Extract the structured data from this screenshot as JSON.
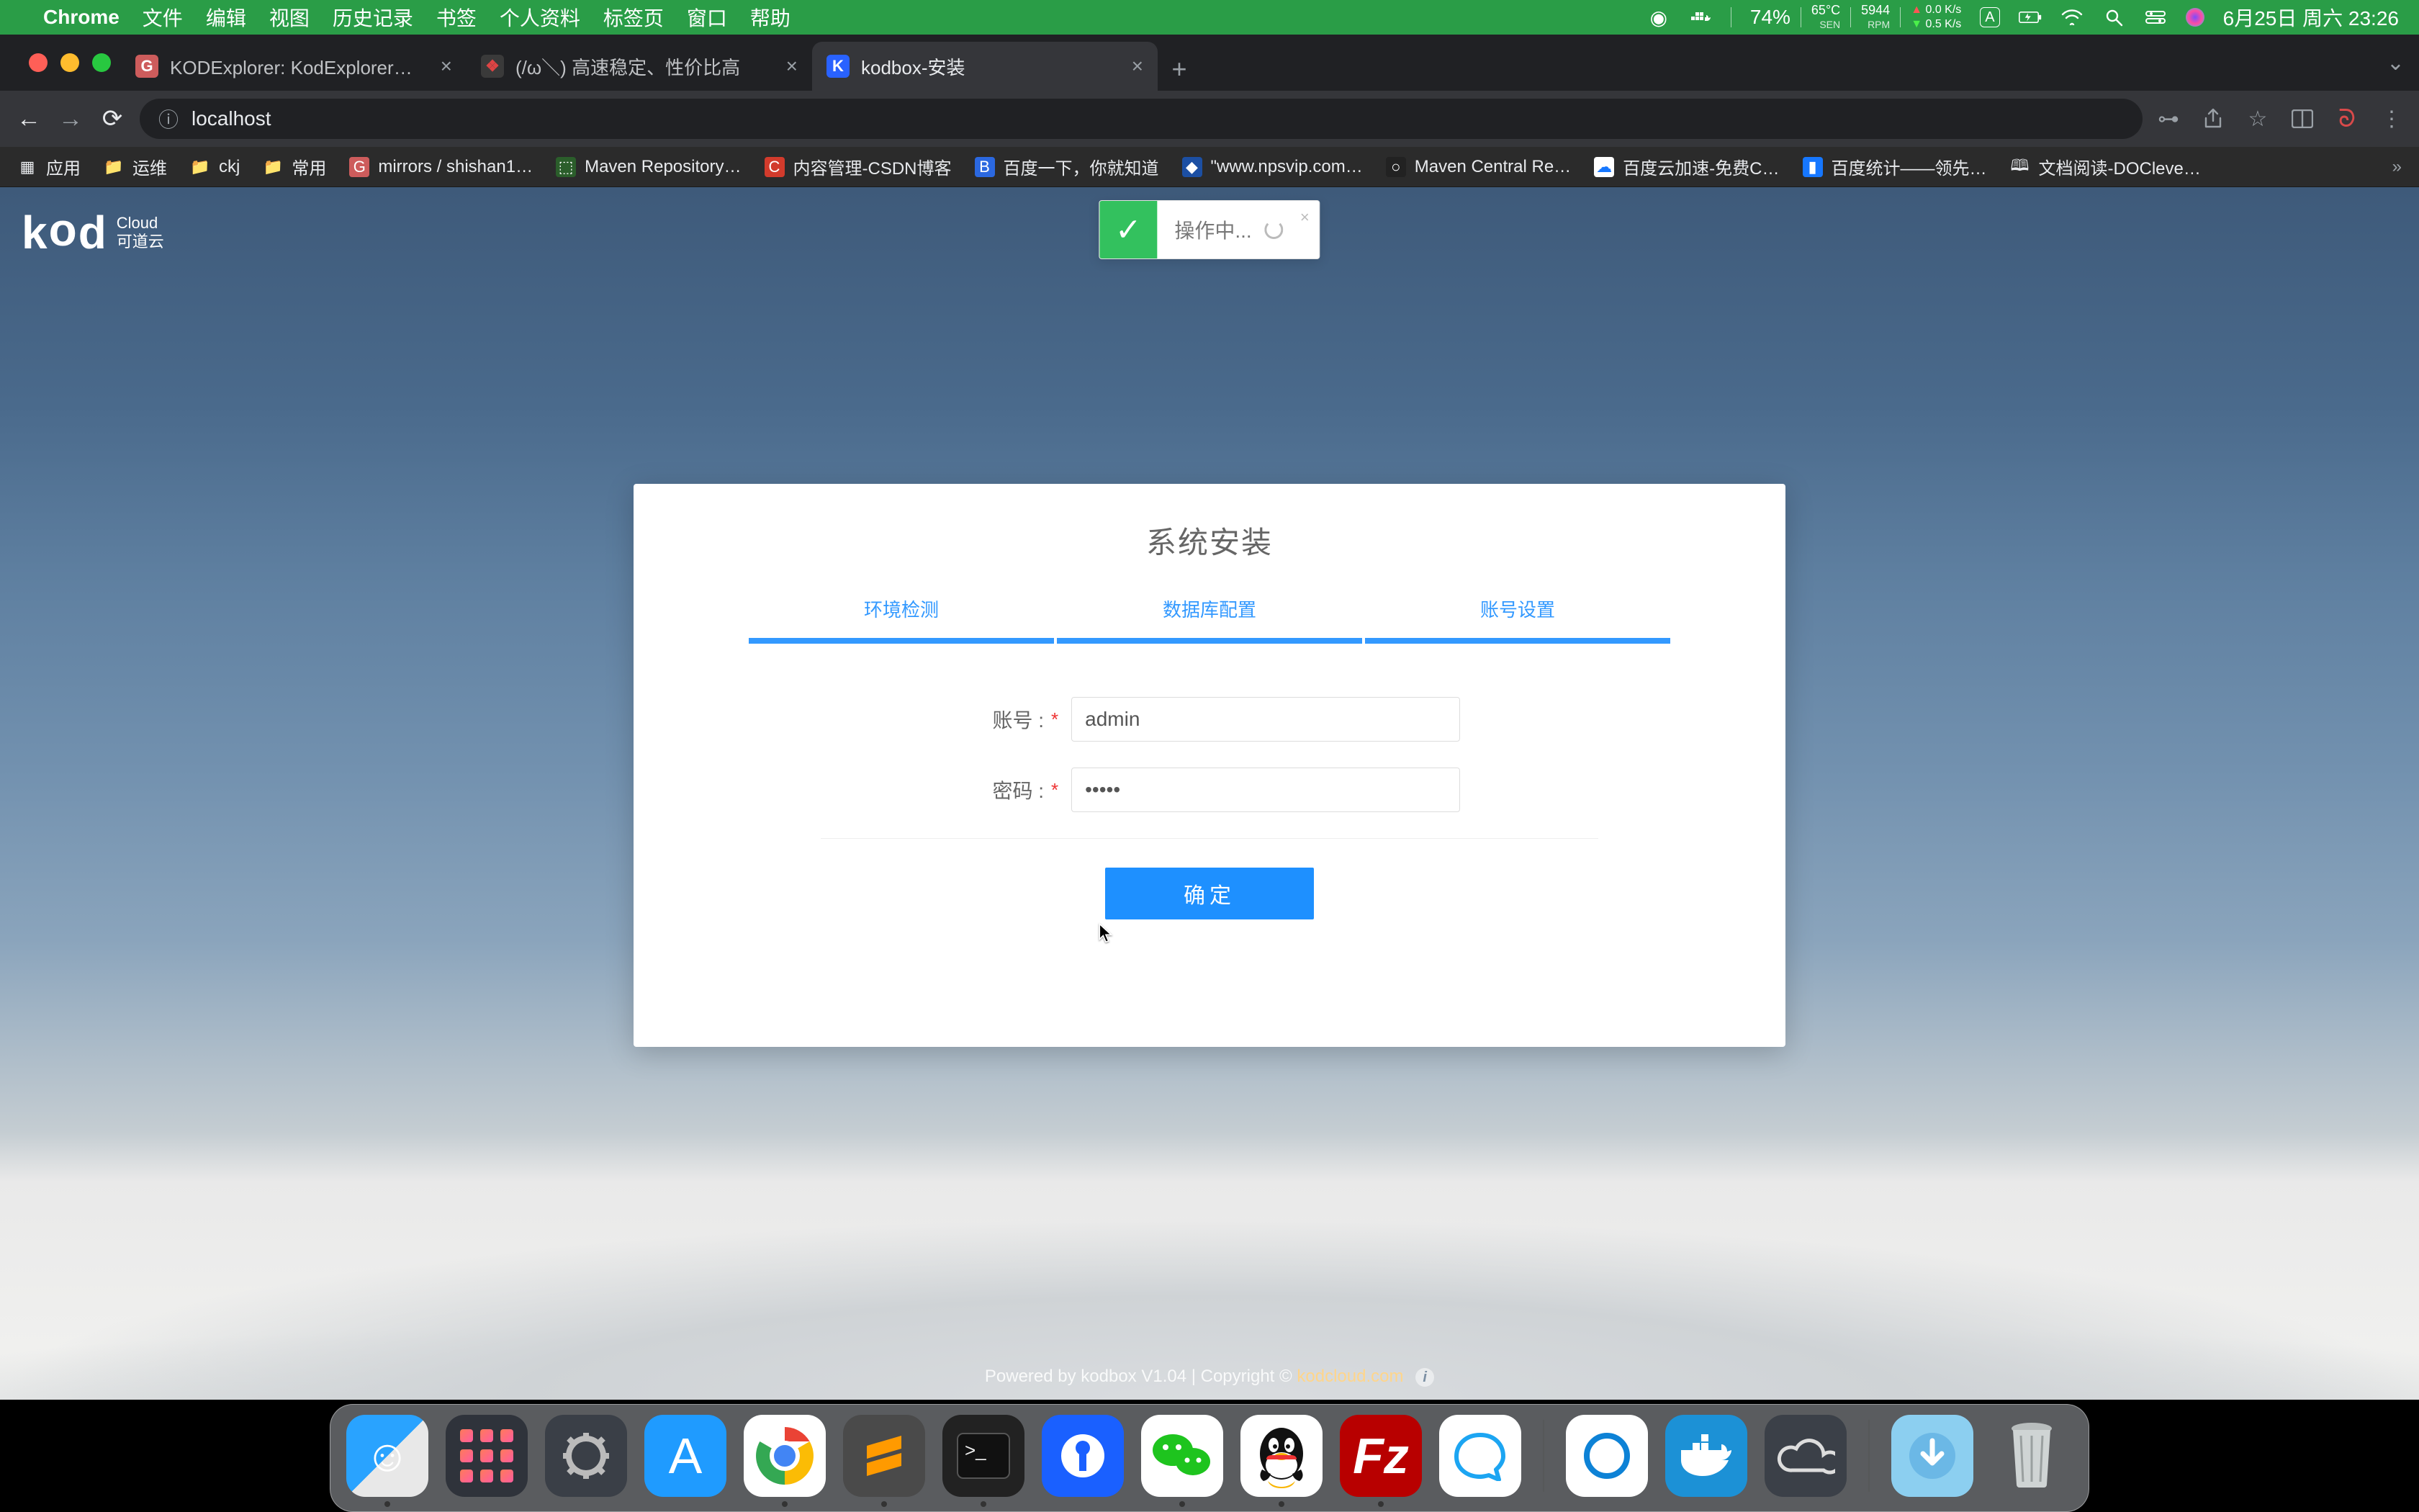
{
  "menubar": {
    "app": "Chrome",
    "items": [
      "文件",
      "编辑",
      "视图",
      "历史记录",
      "书签",
      "个人资料",
      "标签页",
      "窗口",
      "帮助"
    ],
    "pct": "74%",
    "temp": "65°C",
    "temp_sub": "SEN",
    "rpm": "5944",
    "rpm_sub": "RPM",
    "net_up": "0.0 K/s",
    "net_down": "0.5 K/s",
    "ime": "A",
    "date": "6月25日 周六 23:26"
  },
  "tabs": [
    {
      "title": "KODExplorer: KodExplorer是一…",
      "favclass": "fav-g",
      "favtxt": "G"
    },
    {
      "title": "(/ω＼) 高速稳定、性价比高",
      "favclass": "fav-r",
      "favtxt": "❖"
    },
    {
      "title": "kodbox-安装",
      "favclass": "fav-k",
      "favtxt": "K"
    }
  ],
  "toolbar": {
    "url": "localhost"
  },
  "bookmarks": [
    {
      "icon": "▦",
      "label": "应用",
      "cls": ""
    },
    {
      "icon": "📁",
      "label": "运维",
      "cls": ""
    },
    {
      "icon": "📁",
      "label": "ckj",
      "cls": ""
    },
    {
      "icon": "📁",
      "label": "常用",
      "cls": ""
    },
    {
      "icon": "G",
      "label": "mirrors / shishan1…",
      "cls": "fav-g"
    },
    {
      "icon": "M",
      "label": "Maven Repository…",
      "cls": ""
    },
    {
      "icon": "C",
      "label": "内容管理-CSDN博客",
      "cls": ""
    },
    {
      "icon": "B",
      "label": "百度一下，你就知道",
      "cls": ""
    },
    {
      "icon": "◆",
      "label": "\"www.npsvip.com…",
      "cls": ""
    },
    {
      "icon": "○",
      "label": "Maven Central Re…",
      "cls": ""
    },
    {
      "icon": "☁",
      "label": "百度云加速-免费C…",
      "cls": ""
    },
    {
      "icon": "▮",
      "label": "百度统计——领先…",
      "cls": ""
    },
    {
      "icon": "🕮",
      "label": "文档阅读-DOCleve…",
      "cls": ""
    }
  ],
  "logo": {
    "main": "kod",
    "sub1": "Cloud",
    "sub2": "可道云"
  },
  "toast": {
    "text": "操作中..."
  },
  "card": {
    "title": "系统安装",
    "steps": [
      "环境检测",
      "数据库配置",
      "账号设置"
    ],
    "account_label": "账号 :",
    "password_label": "密码 :",
    "account_value": "admin",
    "password_value": "•••••",
    "submit": "确定"
  },
  "footer": {
    "pre": "Powered by kodbox V1.04   |   Copyright © ",
    "link": "kodcloud.com"
  },
  "dock": {
    "downloads": "↓"
  }
}
